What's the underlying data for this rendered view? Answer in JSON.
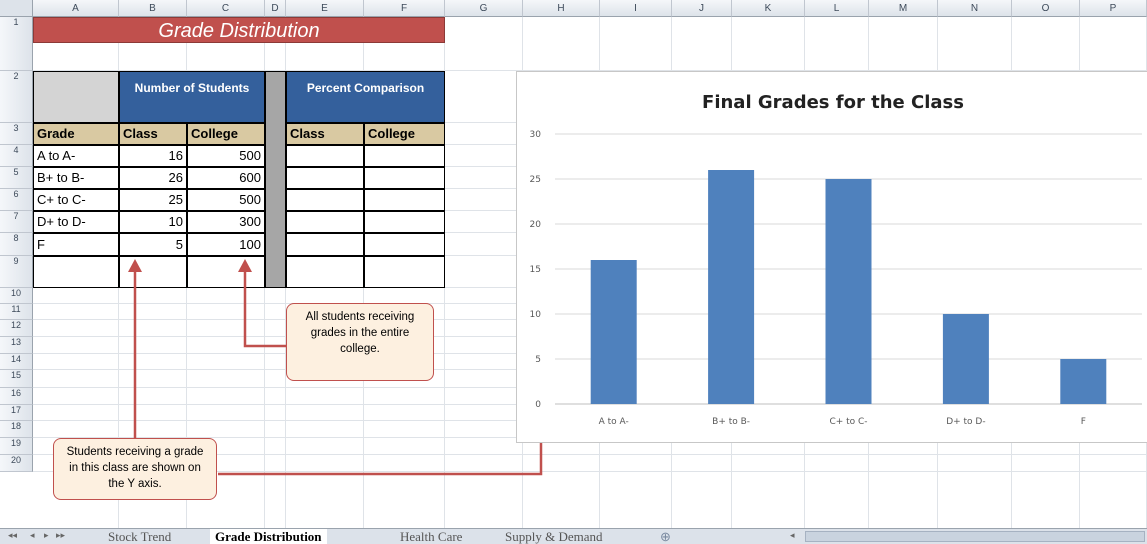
{
  "columns": [
    "A",
    "B",
    "C",
    "D",
    "E",
    "F",
    "G",
    "H",
    "I",
    "J",
    "K",
    "L",
    "M",
    "N",
    "O",
    "P"
  ],
  "rows": [
    "1",
    "2",
    "3",
    "4",
    "5",
    "6",
    "7",
    "8",
    "9",
    "10",
    "11",
    "12",
    "13",
    "14",
    "15",
    "16",
    "17",
    "18",
    "19",
    "20"
  ],
  "table": {
    "title": "Grade Distribution",
    "group_headers": {
      "students": "Number of Students",
      "percent": "Percent Comparison"
    },
    "col_headers": {
      "grade": "Grade",
      "class1": "Class",
      "college1": "College",
      "class2": "Class",
      "college2": "College"
    },
    "rows": [
      {
        "grade": "A to A-",
        "class": "16",
        "college": "500"
      },
      {
        "grade": "B+ to B-",
        "class": "26",
        "college": "600"
      },
      {
        "grade": "C+ to C-",
        "class": "25",
        "college": "500"
      },
      {
        "grade": "D+ to D-",
        "class": "10",
        "college": "300"
      },
      {
        "grade": "F",
        "class": "5",
        "college": "100"
      }
    ]
  },
  "callouts": {
    "college": "All students receiving grades in the entire college.",
    "class": "Students receiving a grade in this class are shown on the Y axis."
  },
  "colors": {
    "title_fill": "#c0504d",
    "header_blue": "#34609c",
    "header_tan": "#d9c9a2",
    "bar": "#4f81bd",
    "arrow": "#c0504d"
  },
  "chart_data": {
    "type": "bar",
    "title": "Final Grades for the Class",
    "categories": [
      "A to A-",
      "B+ to B-",
      "C+ to C-",
      "D+ to D-",
      "F"
    ],
    "values": [
      16,
      26,
      25,
      10,
      5
    ],
    "ylim": [
      0,
      30
    ],
    "yticks": [
      "0",
      "5",
      "10",
      "15",
      "20",
      "25",
      "30"
    ],
    "grid": true,
    "legend": "none"
  },
  "sheet_tabs": {
    "items": [
      "Stock Trend",
      "Grade Distribution",
      "Health Care",
      "Supply & Demand"
    ],
    "active": "Grade Distribution"
  }
}
